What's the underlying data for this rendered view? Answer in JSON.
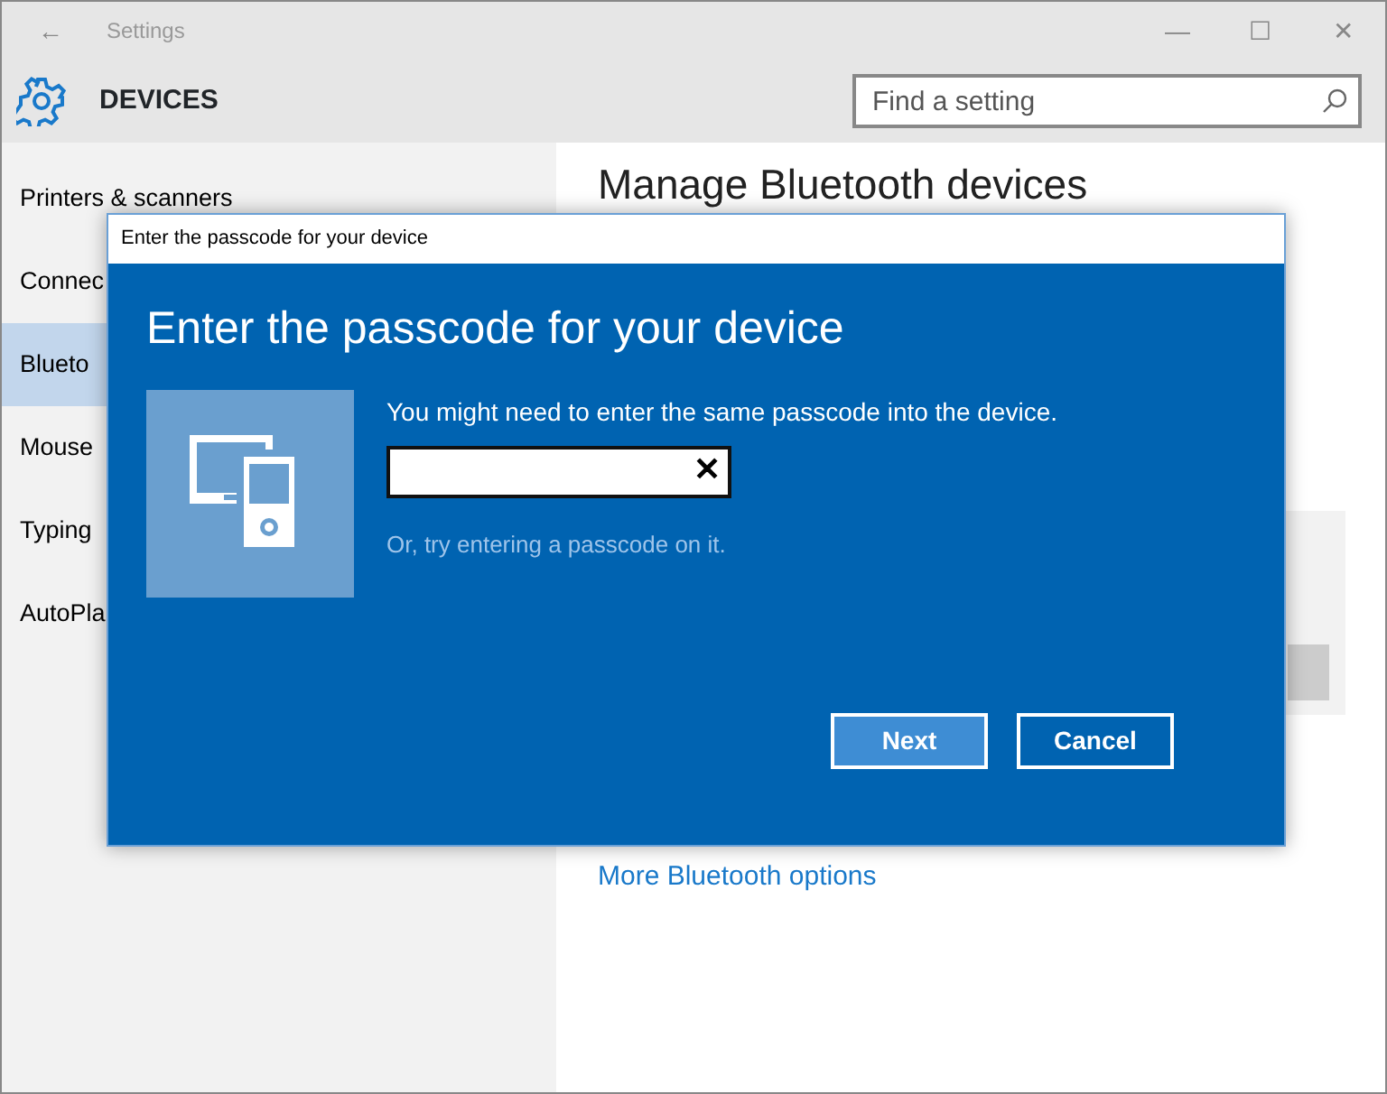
{
  "window": {
    "title": "Settings",
    "back": "←",
    "controls": [
      "—",
      "☐",
      "✕"
    ]
  },
  "header": {
    "title": "DEVICES",
    "search": {
      "placeholder": "Find a setting"
    }
  },
  "sidebar": {
    "items": [
      {
        "label": "Printers & scanners",
        "selected": false
      },
      {
        "label": "Connec",
        "selected": false
      },
      {
        "label": "Blueto",
        "selected": true
      },
      {
        "label": "Mouse",
        "selected": false
      },
      {
        "label": "Typing",
        "selected": false
      },
      {
        "label": "AutoPla",
        "selected": false
      }
    ]
  },
  "main": {
    "heading": "Manage Bluetooth devices",
    "link": "More Bluetooth options"
  },
  "dialog": {
    "title": "Enter the passcode for your device",
    "heading": "Enter the passcode for your device",
    "instruction": "You might need to enter the same passcode into the device.",
    "clear": "✕",
    "hint": "Or, try entering a passcode on it.",
    "buttons": [
      {
        "label": "Next",
        "kind": "primary"
      },
      {
        "label": "Cancel",
        "kind": "secondary"
      }
    ]
  }
}
